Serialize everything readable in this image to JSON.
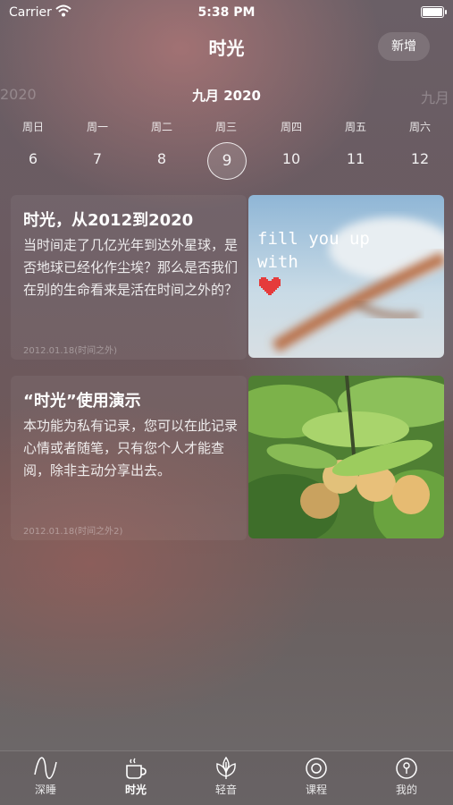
{
  "status": {
    "carrier": "Carrier",
    "time": "5:38 PM"
  },
  "header": {
    "title": "时光",
    "add_label": "新增"
  },
  "calendar": {
    "prev_label": "2020",
    "current_label": "九月 2020",
    "next_label": "九月",
    "weekdays": [
      "周日",
      "周一",
      "周二",
      "周三",
      "周四",
      "周五",
      "周六"
    ],
    "dates": [
      "6",
      "7",
      "8",
      "9",
      "10",
      "11",
      "12"
    ],
    "selected_index": 3
  },
  "entries": [
    {
      "title": "时光，从2012到2020",
      "body": "当时间走了几亿光年到达外星球，是否地球已经化作尘埃？那么是否我们在别的生命看来是活在时间之外的？",
      "date": "2012.01.18(时间之外)",
      "image_caption_1": "fill you up",
      "image_caption_2": "with"
    },
    {
      "title": "“时光”使用演示",
      "body": "本功能为私有记录，您可以在此记录心情或者随笔，只有您个人才能查阅，除非主动分享出去。",
      "date": "2012.01.18(时间之外2)"
    }
  ],
  "tabs": [
    {
      "label": "深睡",
      "icon": "wave-icon"
    },
    {
      "label": "时光",
      "icon": "cup-icon",
      "active": true
    },
    {
      "label": "轻音",
      "icon": "leaf-icon"
    },
    {
      "label": "课程",
      "icon": "circle-target-icon"
    },
    {
      "label": "我的",
      "icon": "profile-icon"
    }
  ],
  "colors": {
    "heart": "#e53b3b",
    "fruit": "#e8c07a",
    "leaf": "#5f9a3c"
  }
}
